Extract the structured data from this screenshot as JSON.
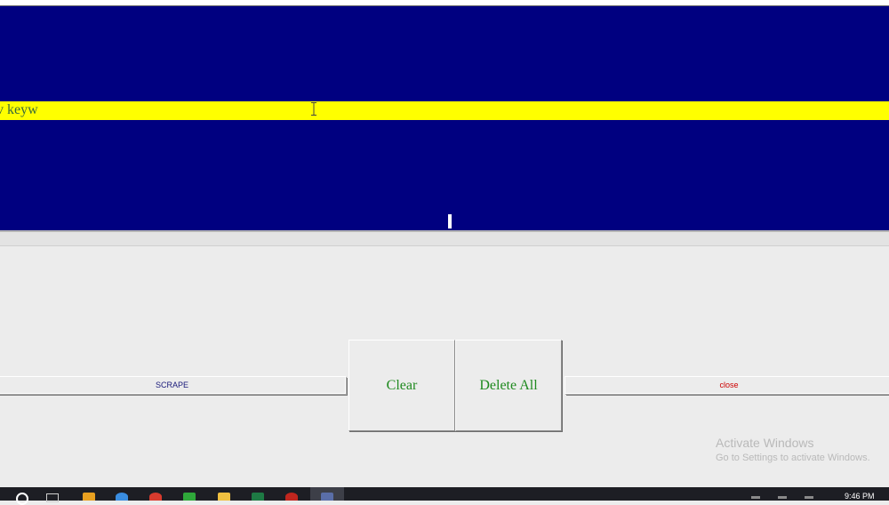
{
  "editor": {
    "line_text": "v keyw"
  },
  "buttons": {
    "scrape_label": "SCRAPE",
    "clear_label": "Clear",
    "delete_all_label": "Delete All",
    "close_label": "close"
  },
  "watermark": {
    "title": "Activate Windows",
    "subtitle": "Go to Settings to activate Windows."
  },
  "taskbar": {
    "time": "9:46 PM",
    "icons": [
      "search-icon",
      "task-view-icon",
      "file-explorer-icon",
      "edge-icon",
      "chrome-icon",
      "app-icon",
      "folder-icon",
      "excel-icon",
      "opera-icon",
      "python-icon"
    ]
  },
  "colors": {
    "editor_background": "#000080",
    "highlight_line": "#ffff00",
    "button_text_green": "#1f8a1f",
    "close_text": "#cc0000",
    "scrape_text": "#1a1a7a"
  }
}
